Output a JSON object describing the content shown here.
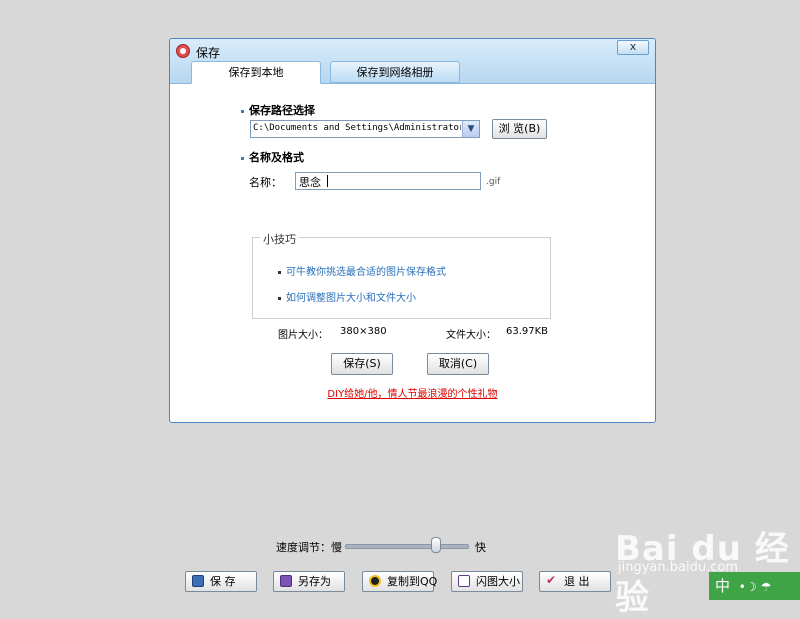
{
  "dialog": {
    "title": "保存",
    "close_label": "x",
    "tabs": [
      {
        "label": "保存到本地",
        "active": true
      },
      {
        "label": "保存到网络相册",
        "active": false
      }
    ],
    "path_section": {
      "title": "保存路径选择",
      "path_value": "C:\\Documents and Settings\\Administrator\\",
      "browse_label": "浏 览(B)"
    },
    "name_section": {
      "title": "名称及格式",
      "name_label": "名称：",
      "name_value": "思念",
      "extension": ".gif"
    },
    "tips": {
      "legend": "小技巧",
      "items": [
        "可牛教你挑选最合适的图片保存格式",
        "如何调整图片大小和文件大小"
      ]
    },
    "info": {
      "image_size_label": "图片大小：",
      "image_size_value": "380×380",
      "file_size_label": "文件大小：",
      "file_size_value": "63.97KB"
    },
    "save_label": "保存(S)",
    "cancel_label": "取消(C)",
    "promo_link": "DIY给她/他，情人节最浪漫的个性礼物"
  },
  "toolbar": {
    "speed_label": "速度调节：慢",
    "speed_fast": "快",
    "speed_level": 0.75,
    "buttons": [
      "保 存",
      "另存为",
      "复制到QQ",
      "闪图大小",
      "退 出"
    ]
  },
  "watermark": {
    "brand": "Bai du 经验",
    "url": "jingyan.baidu.com"
  },
  "ime": {
    "label": "中",
    "symbols": "•☽ ☂"
  },
  "colors": {
    "accent": "#4c86bf",
    "link": "#2a6fba",
    "promo": "#e00000"
  }
}
